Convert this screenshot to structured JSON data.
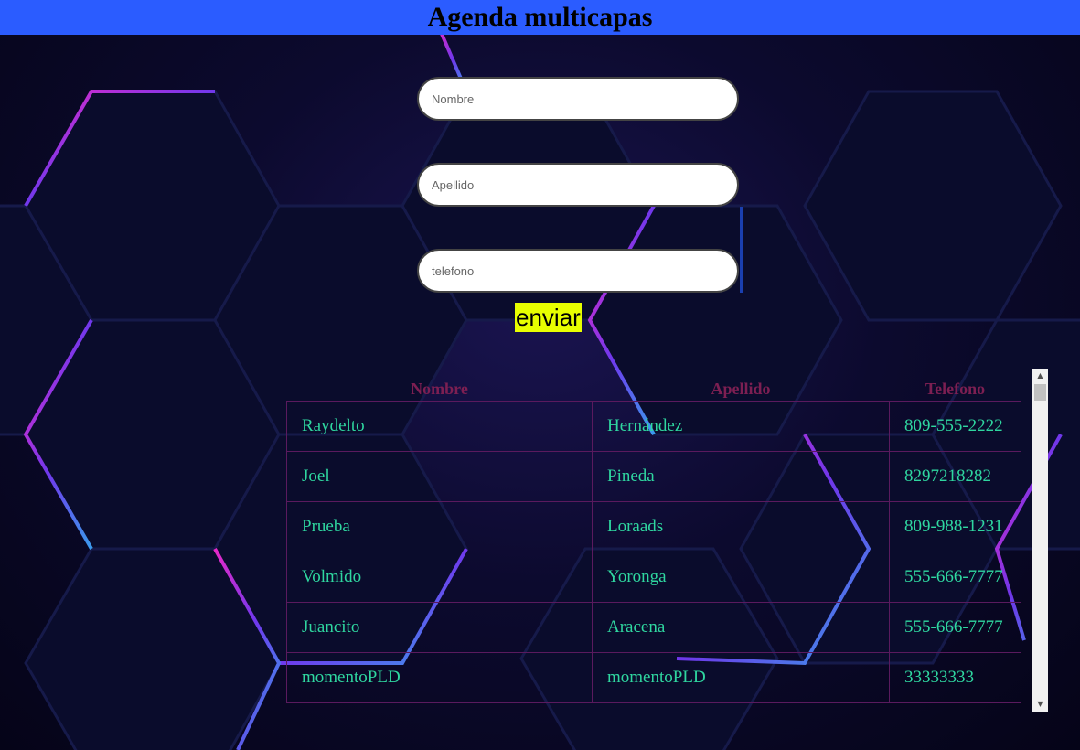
{
  "header": {
    "title": "Agenda multicapas"
  },
  "form": {
    "nombre_placeholder": "Nombre",
    "apellido_placeholder": "Apellido",
    "telefono_placeholder": "telefono",
    "submit_label": "enviar"
  },
  "table": {
    "headers": [
      "Nombre",
      "Apellido",
      "Telefono"
    ],
    "rows": [
      [
        "Raydelto",
        "Hernández",
        "809-555-2222"
      ],
      [
        "Joel",
        "Pineda",
        "8297218282"
      ],
      [
        "Prueba",
        "Loraads",
        "809-988-1231"
      ],
      [
        "Volmido",
        "Yoronga",
        "555-666-7777"
      ],
      [
        "Juancito",
        "Aracena",
        "555-666-7777"
      ],
      [
        "momentoPLD",
        "momentoPLD",
        "33333333"
      ]
    ]
  },
  "colors": {
    "header_bg": "#2b5cff",
    "button_bg": "#e8ff00",
    "table_header_text": "#7d1f52",
    "table_cell_text": "#2fd7a0"
  },
  "icons": {
    "scroll_up": "▲",
    "scroll_down": "▼"
  }
}
